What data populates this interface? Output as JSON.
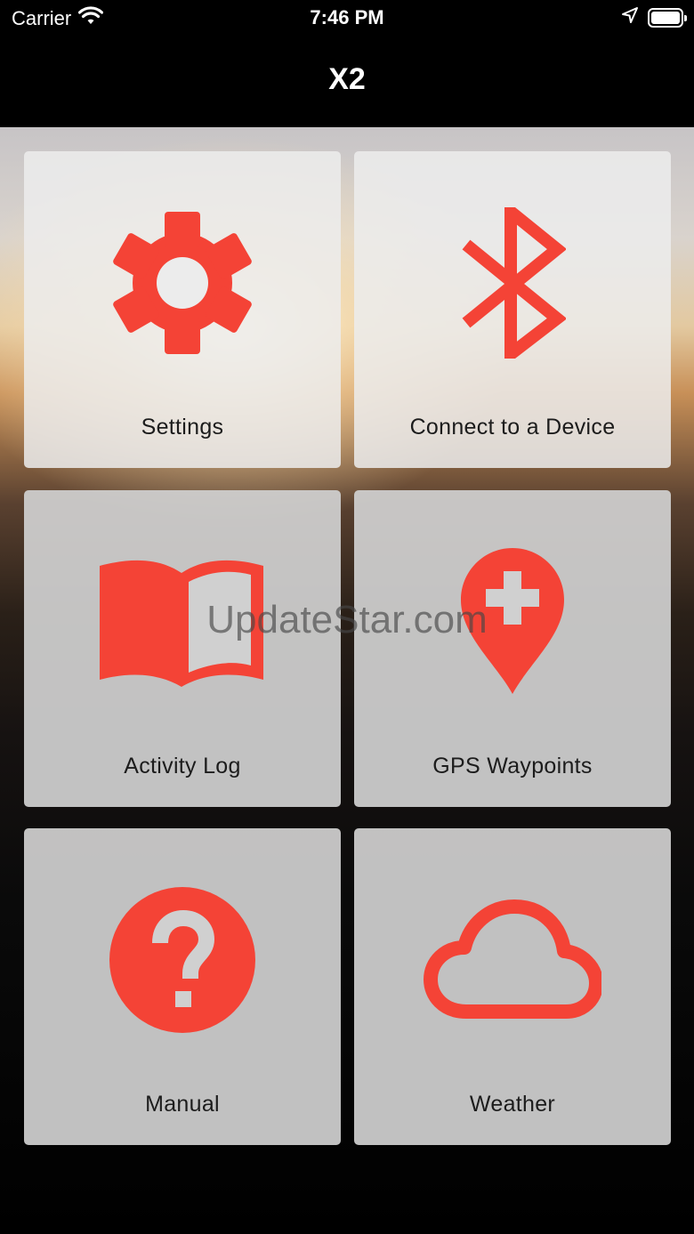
{
  "status_bar": {
    "carrier": "Carrier",
    "time": "7:46 PM",
    "icons": [
      "wifi-icon",
      "location-arrow-icon",
      "battery-icon"
    ]
  },
  "nav": {
    "title": "X2"
  },
  "tiles": [
    {
      "label": "Settings",
      "icon": "gear-icon"
    },
    {
      "label": "Connect to a Device",
      "icon": "bluetooth-icon"
    },
    {
      "label": "Activity Log",
      "icon": "open-book-icon"
    },
    {
      "label": "GPS Waypoints",
      "icon": "map-pin-plus-icon"
    },
    {
      "label": "Manual",
      "icon": "help-circle-icon"
    },
    {
      "label": "Weather",
      "icon": "cloud-icon"
    }
  ],
  "watermark": "UpdateStar.com",
  "colors": {
    "accent": "#F44336",
    "tile": "#D0D0D0",
    "bars": "#000000"
  }
}
